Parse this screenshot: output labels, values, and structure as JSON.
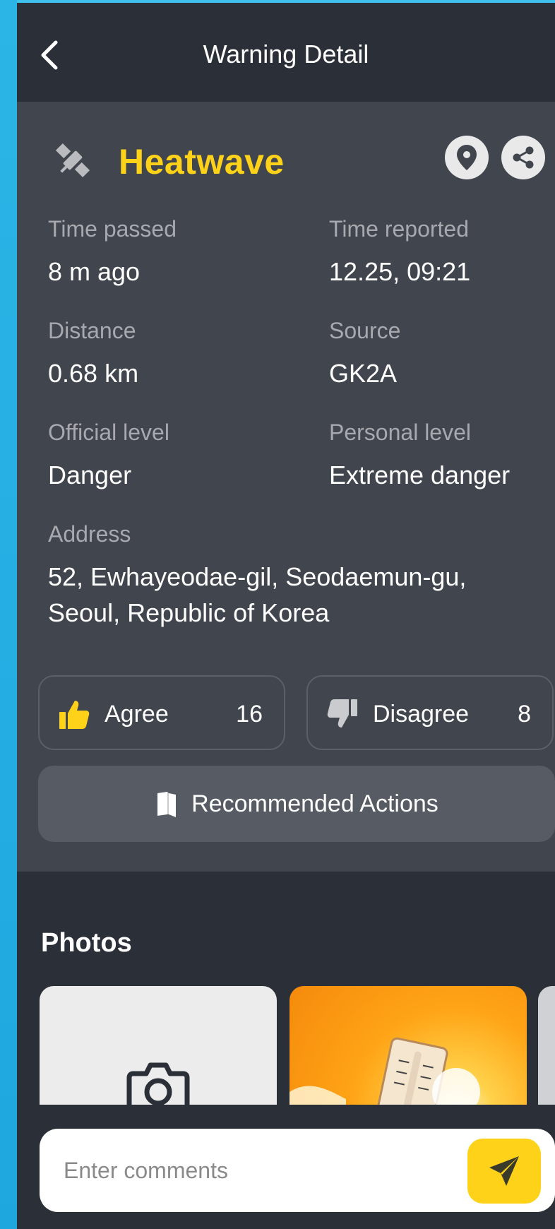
{
  "header": {
    "title": "Warning Detail"
  },
  "warning": {
    "title": "Heatwave",
    "title_color": "#ffd21a",
    "icon": "satellite-icon",
    "fields": {
      "time_passed": {
        "label": "Time passed",
        "value": "8 m ago"
      },
      "time_reported": {
        "label": "Time reported",
        "value": "12.25, 09:21"
      },
      "distance": {
        "label": "Distance",
        "value": "0.68 km"
      },
      "source": {
        "label": "Source",
        "value": "GK2A"
      },
      "official_level": {
        "label": "Official level",
        "value": "Danger"
      },
      "personal_level": {
        "label": "Personal level",
        "value": "Extreme danger"
      },
      "address": {
        "label": "Address",
        "value": "52, Ewhayeodae-gil, Seodaemun-gu, Seoul, Republic of Korea"
      }
    }
  },
  "votes": {
    "agree": {
      "label": "Agree",
      "count": "16",
      "icon": "thumbs-up-icon"
    },
    "disagree": {
      "label": "Disagree",
      "count": "8",
      "icon": "thumbs-down-icon"
    }
  },
  "actions": {
    "label": "Recommended Actions",
    "icon": "book-icon"
  },
  "photos": {
    "title": "Photos"
  },
  "comment": {
    "placeholder": "Enter comments"
  },
  "colors": {
    "accent": "#ffd21a",
    "background": "#2b2f38",
    "card": "#41454e"
  }
}
